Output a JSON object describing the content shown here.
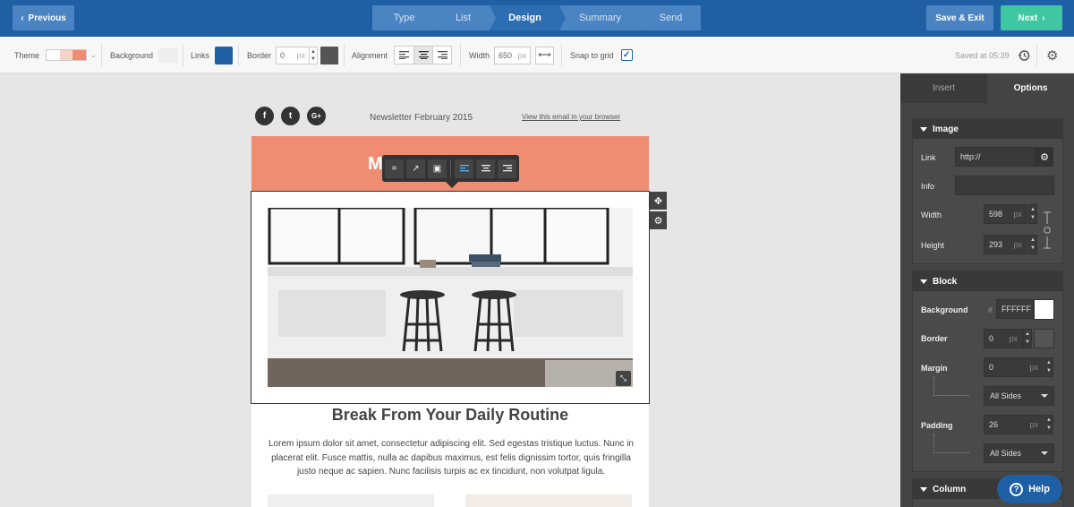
{
  "topbar": {
    "previous_label": "Previous",
    "steps": [
      "Type",
      "List",
      "Design",
      "Summary",
      "Send"
    ],
    "active_step": "Design",
    "save_exit_label": "Save & Exit",
    "next_label": "Next"
  },
  "toolbar": {
    "theme_label": "Theme",
    "theme_colors": [
      "#ffffff",
      "#f6d3c8",
      "#ef8d73"
    ],
    "background_label": "Background",
    "background_color": "#eeeeee",
    "links_label": "Links",
    "links_color": "#1f5fa3",
    "border_label": "Border",
    "border_value": "0",
    "border_unit": "px",
    "border_color": "#555555",
    "alignment_label": "Alignment",
    "alignment_selected": "center",
    "width_label": "Width",
    "width_value": "650",
    "width_unit": "px",
    "snap_label": "Snap to grid",
    "snap_checked": true,
    "saved_text": "Saved at 05:39"
  },
  "email": {
    "social_icons": [
      "facebook-icon",
      "twitter-icon",
      "google-plus-icon"
    ],
    "newsletter_date": "Newsletter February 2015",
    "view_in_browser": "View this email in your browser",
    "header_color": "#ef8d73",
    "logo_text_visible": "M                T",
    "headline": "Break From Your Daily Routine",
    "body_text": "Lorem ipsum dolor sit amet, consectetur adipiscing elit. Sed egestas tristique luctus. Nunc in placerat elit. Fusce mattis, nulla ac dapibus maximus, est felis dignissim tortor, quis fringilla justo neque ac sapien. Nunc facilisis turpis ac ex tincidunt, non volutpat ligula."
  },
  "panel": {
    "tabs": [
      "Insert",
      "Options"
    ],
    "active_tab": "Options",
    "image_section": {
      "title": "Image",
      "link_label": "Link",
      "link_value": "http://",
      "info_label": "Info",
      "info_value": "",
      "width_label": "Width",
      "width_value": "598",
      "height_label": "Height",
      "height_value": "293",
      "unit": "px"
    },
    "block_section": {
      "title": "Block",
      "background_label": "Background",
      "background_hash": "#",
      "background_value": "FFFFFF",
      "border_label": "Border",
      "border_value": "0",
      "margin_label": "Margin",
      "margin_value": "0",
      "margin_sides": "All Sides",
      "padding_label": "Padding",
      "padding_value": "26",
      "padding_sides": "All Sides",
      "unit": "px"
    },
    "column_section": {
      "title": "Column"
    },
    "help_label": "Help"
  }
}
